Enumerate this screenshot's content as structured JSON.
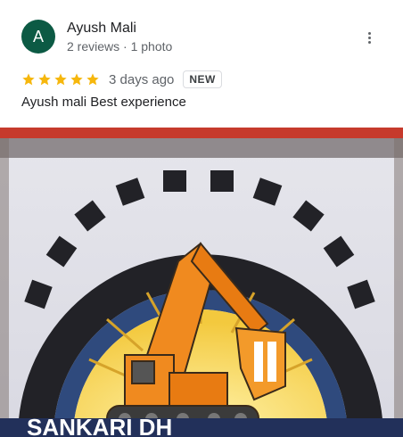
{
  "reviewer": {
    "avatar_letter": "A",
    "name": "Ayush Mali",
    "meta": "2 reviews · 1 photo"
  },
  "review": {
    "rating": 5,
    "age": "3 days ago",
    "badge": "NEW",
    "text": "Ayush mali Best experience"
  },
  "icons": {
    "menu": "more-vert-icon",
    "star": "star-icon"
  },
  "colors": {
    "avatar_bg": "#0c5a44",
    "star": "#f6b70d",
    "text_primary": "#202124",
    "text_secondary": "#5f6368"
  },
  "photo": {
    "description": "Photo of an excavator logo on a screen"
  }
}
